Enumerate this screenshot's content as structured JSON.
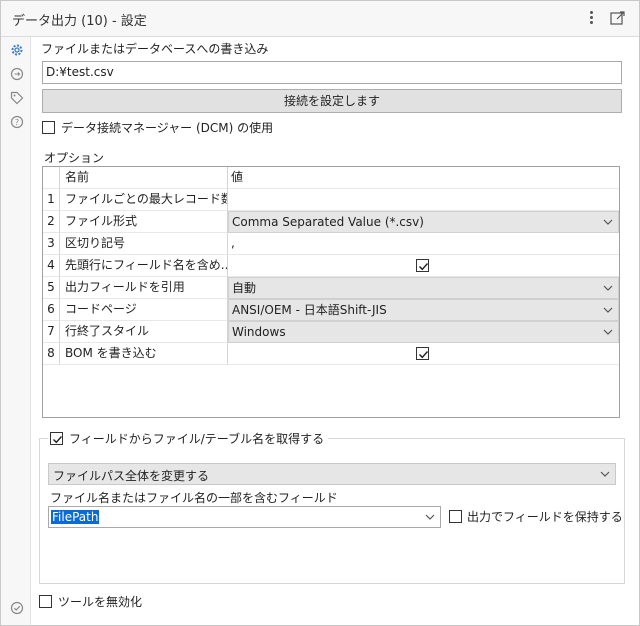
{
  "window": {
    "title": "データ出力 (10) - 設定"
  },
  "output": {
    "section_label": "ファイルまたはデータベースへの書き込み",
    "path_value": "D:¥test.csv",
    "connect_button": "接続を設定します",
    "dcm_label": "データ接続マネージャー (DCM) の使用",
    "dcm_checked": false
  },
  "options": {
    "section_label": "オプション",
    "header": {
      "name": "名前",
      "value": "値"
    },
    "rows": [
      {
        "num": "1",
        "name": "ファイルごとの最大レコード数",
        "value": ""
      },
      {
        "num": "2",
        "name": "ファイル形式",
        "value": "Comma Separated Value (*.csv)"
      },
      {
        "num": "3",
        "name": "区切り記号",
        "value": ","
      },
      {
        "num": "4",
        "name": "先頭行にフィールド名を含め...",
        "value": "",
        "checked": true
      },
      {
        "num": "5",
        "name": "出力フィールドを引用",
        "value": "自動"
      },
      {
        "num": "6",
        "name": "コードページ",
        "value": "ANSI/OEM - 日本語Shift-JIS"
      },
      {
        "num": "7",
        "name": "行終了スタイル",
        "value": "Windows"
      },
      {
        "num": "8",
        "name": "BOM を書き込む",
        "value": "",
        "checked": true
      }
    ]
  },
  "filename_group": {
    "checkbox_label": "フィールドからファイル/テーブル名を取得する",
    "checked": true,
    "mode_value": "ファイルパス全体を変更する",
    "field_label": "ファイル名またはファイル名の一部を含むフィールド",
    "field_value": "FilePath",
    "keep_label": "出力でフィールドを保持する",
    "keep_checked": false
  },
  "footer": {
    "disable_label": "ツールを無効化",
    "disable_checked": false
  },
  "icons": {
    "sidebar": [
      "gear-icon",
      "connection-icon",
      "tag-icon",
      "help-icon",
      "check-circle-icon"
    ]
  },
  "colors": {
    "selection": "#0a6ad6",
    "accent": "#3a7bd5"
  }
}
